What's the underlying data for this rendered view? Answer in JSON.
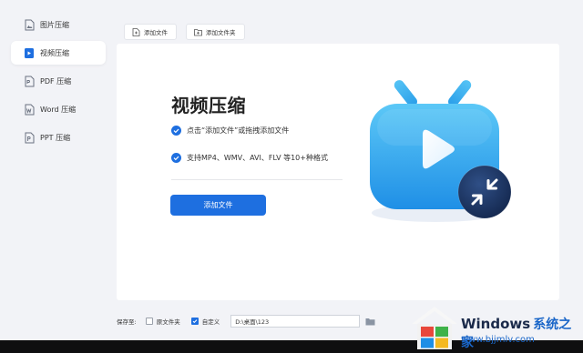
{
  "sidebar": {
    "items": [
      {
        "label": "图片压缩",
        "icon": "image-file-icon",
        "active": false
      },
      {
        "label": "视频压缩",
        "icon": "video-file-icon",
        "active": true
      },
      {
        "label": "PDF 压缩",
        "icon": "pdf-file-icon",
        "active": false
      },
      {
        "label": "Word 压缩",
        "icon": "word-file-icon",
        "active": false
      },
      {
        "label": "PPT 压缩",
        "icon": "ppt-file-icon",
        "active": false
      }
    ]
  },
  "toolbar": {
    "add_file": "添加文件",
    "add_folder": "添加文件夹"
  },
  "main": {
    "title": "视频压缩",
    "features": [
      "点击“添加文件”或拖拽添加文件",
      "支持MP4、WMV、AVI、FLV 等10+种格式"
    ],
    "add_button": "添加文件",
    "illustration": "tv-play-compress-icon"
  },
  "bottom": {
    "save_to_label": "保存至:",
    "original_folder_label": "原文件夹",
    "original_folder_checked": false,
    "custom_label": "自定义",
    "custom_checked": true,
    "path_value": "D:\\桌面\\123"
  },
  "watermark": {
    "title": "Windows",
    "title_cn": "系统之家",
    "url": "www.bjjmlv.com"
  },
  "colors": {
    "accent": "#1e6fe0",
    "background": "#f2f3f7",
    "tv_blue": "#2fa6ef"
  }
}
